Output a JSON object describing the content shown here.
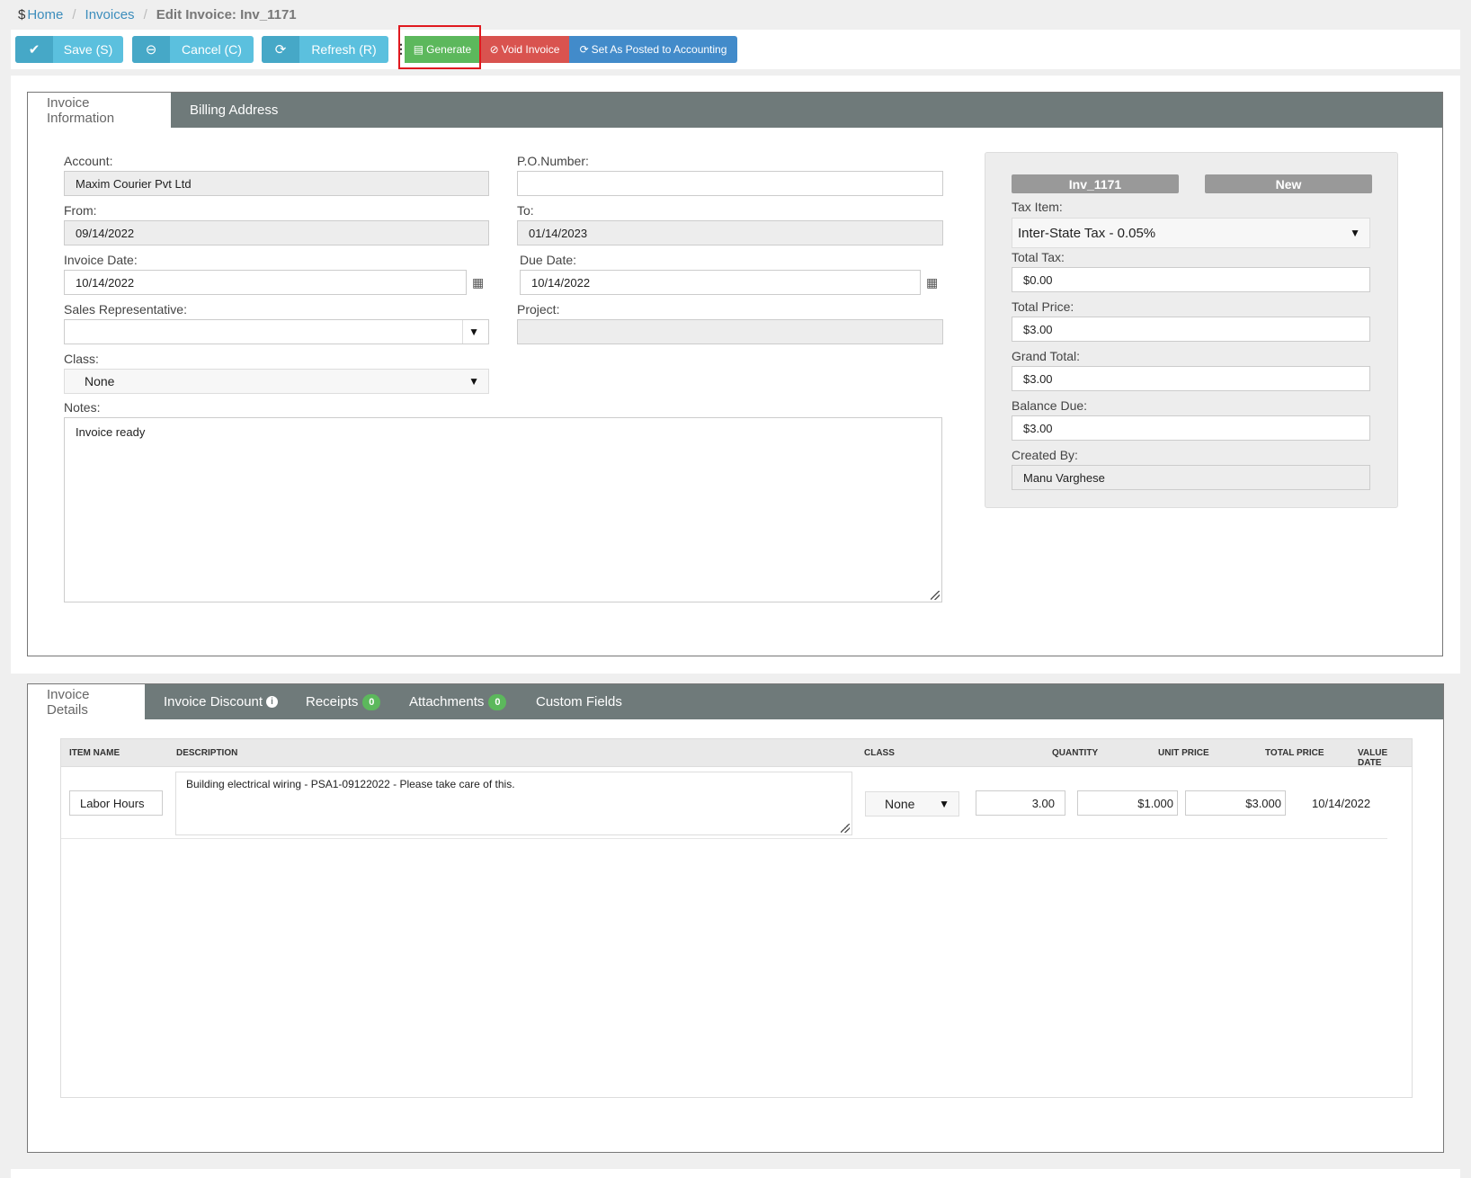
{
  "breadcrumb": {
    "prefix": "$",
    "home": "Home",
    "invoices": "Invoices",
    "current": "Edit Invoice: Inv_1171"
  },
  "toolbar": {
    "save": "Save (S)",
    "cancel": "Cancel (C)",
    "refresh": "Refresh (R)",
    "more": "⋮",
    "generate": "Generate",
    "void": "Void Invoice",
    "posted": "Set As Posted to Accounting"
  },
  "tabs_top": {
    "info": "Invoice Information",
    "billing": "Billing Address"
  },
  "form": {
    "account_label": "Account:",
    "account_value": "Maxim Courier Pvt Ltd",
    "po_label": "P.O.Number:",
    "po_value": "",
    "from_label": "From:",
    "from_value": "09/14/2022",
    "to_label": "To:",
    "to_value": "01/14/2023",
    "invoice_date_label": "Invoice Date:",
    "invoice_date_value": "10/14/2022",
    "due_date_label": "Due Date:",
    "due_date_value": "10/14/2022",
    "sales_rep_label": "Sales Representative:",
    "sales_rep_value": "",
    "project_label": "Project:",
    "project_value": "",
    "class_label": "Class:",
    "class_value": "None",
    "notes_label": "Notes:",
    "notes_value": "Invoice ready"
  },
  "summary": {
    "invoice_no": "Inv_1171",
    "status": "New",
    "tax_item_label": "Tax Item:",
    "tax_item_value": "Inter-State Tax - 0.05%",
    "total_tax_label": "Total Tax:",
    "total_tax_value": "$0.00",
    "total_price_label": "Total Price:",
    "total_price_value": "$3.00",
    "grand_total_label": "Grand Total:",
    "grand_total_value": "$3.00",
    "balance_due_label": "Balance Due:",
    "balance_due_value": "$3.00",
    "created_by_label": "Created By:",
    "created_by_value": "Manu Varghese"
  },
  "tabs_bottom": {
    "details": "Invoice Details",
    "discount": "Invoice Discount",
    "receipts": "Receipts",
    "receipts_count": "0",
    "attachments": "Attachments",
    "attachments_count": "0",
    "custom": "Custom Fields"
  },
  "grid": {
    "headers": [
      "Item Name",
      "Description",
      "Class",
      "Quantity",
      "Unit Price",
      "Total Price",
      "Value Date"
    ],
    "rows": [
      {
        "item": "Labor Hours",
        "description": "Building electrical wiring - PSA1-09122022 - Please take care of this.",
        "class": "None",
        "quantity": "3.00",
        "unit_price": "$1.000",
        "total_price": "$3.000",
        "value_date": "10/14/2022"
      }
    ]
  },
  "colors": {
    "accent_blue": "#5bc0de",
    "green": "#5cb85c",
    "red": "#d9534f",
    "primary": "#428bca",
    "tabbar": "#6f7a7a"
  }
}
